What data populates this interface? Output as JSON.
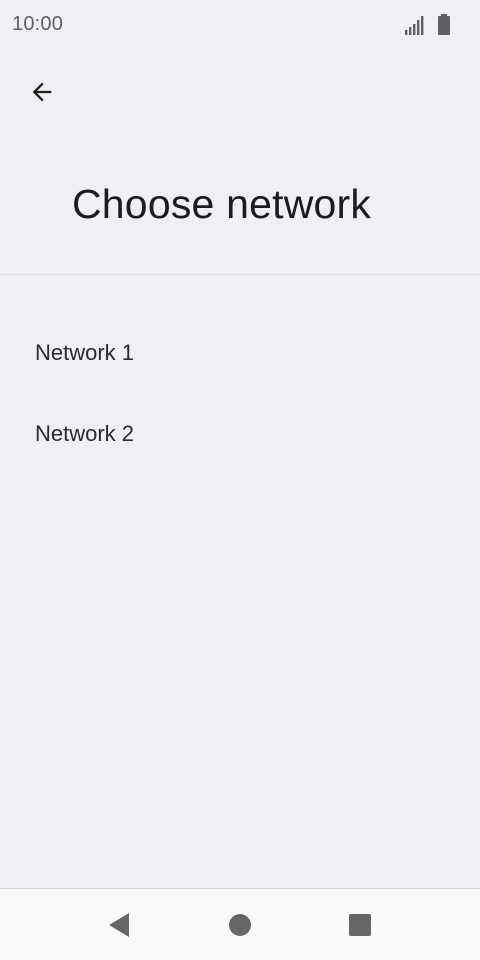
{
  "status_bar": {
    "time": "10:00",
    "icons": [
      "signal-icon",
      "battery-icon"
    ]
  },
  "header": {
    "back_icon": "arrow-back-icon",
    "title": "Choose network"
  },
  "networks": [
    {
      "label": "Network 1"
    },
    {
      "label": "Network 2"
    }
  ],
  "nav_bar": {
    "icons": [
      "nav-back-icon",
      "nav-home-icon",
      "nav-recents-icon"
    ]
  },
  "colors": {
    "background": "#eff0f3",
    "nav_background": "#f9f9f9",
    "text": "#1f1f1f",
    "icon": "#5f6063",
    "nav_icon": "#666666"
  }
}
